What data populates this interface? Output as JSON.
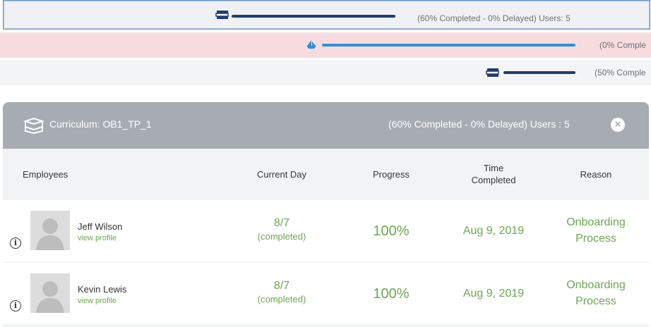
{
  "summary_rows": [
    {
      "text": "(60% Completed - 0% Delayed) Users: 5",
      "icon": "books-icon",
      "bar_color": "#1e3e6e",
      "progress": 1.0
    },
    {
      "text": "(0% Comple",
      "icon": "ship-icon",
      "bar_color": "#2f8fd8",
      "progress": 1.0
    },
    {
      "text": "(50% Comple",
      "icon": "books-icon",
      "bar_color": "#1e3e6e",
      "progress": 1.0
    }
  ],
  "curriculum": {
    "title": "Curriculum: OB1_TP_1",
    "stats": "(60% Completed - 0% Delayed) Users : 5",
    "close_symbol": "×"
  },
  "table": {
    "headers": {
      "employees": "Employees",
      "current_day": "Current Day",
      "progress": "Progress",
      "time_completed_1": "Time",
      "time_completed_2": "Completed",
      "reason": "Reason"
    },
    "rows": [
      {
        "name": "Jeff Wilson",
        "link": "view profile",
        "day": "8/7",
        "day_status": "(completed)",
        "progress": "100%",
        "time": "Aug 9, 2019",
        "reason_1": "Onboarding",
        "reason_2": "Process"
      },
      {
        "name": "Kevin Lewis",
        "link": "view profile",
        "day": "8/7",
        "day_status": "(completed)",
        "progress": "100%",
        "time": "Aug 9, 2019",
        "reason_1": "Onboarding",
        "reason_2": "Process"
      }
    ]
  },
  "colors": {
    "green": "#6aa84f",
    "header_gray": "#a7acb2",
    "dark_bar": "#1e3e6e",
    "blue_bar": "#2f8fd8",
    "pink_row": "#f7dcdf"
  }
}
